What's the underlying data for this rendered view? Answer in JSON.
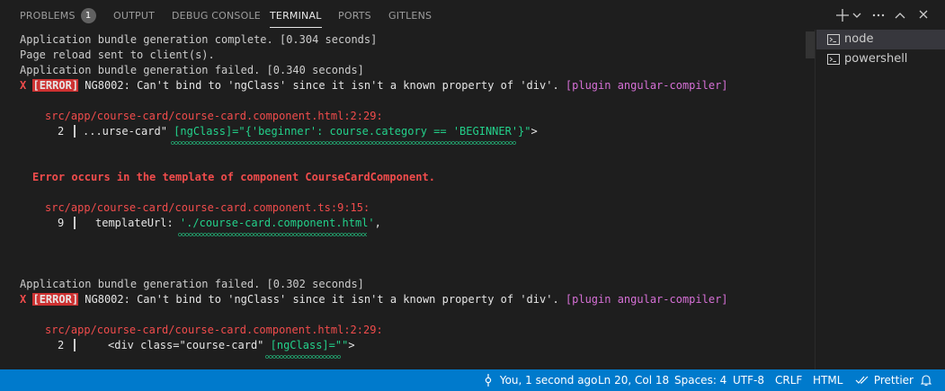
{
  "tabs": [
    {
      "label": "PROBLEMS",
      "badge": "1"
    },
    {
      "label": "OUTPUT"
    },
    {
      "label": "DEBUG CONSOLE"
    },
    {
      "label": "TERMINAL"
    },
    {
      "label": "PORTS"
    },
    {
      "label": "GITLENS"
    }
  ],
  "active_tab": "TERMINAL",
  "terminal_list": [
    {
      "label": "node",
      "icon": "terminal-icon",
      "active": true
    },
    {
      "label": "powershell",
      "icon": "terminal-icon",
      "active": false
    }
  ],
  "terminal": {
    "l1": "Application bundle generation complete. [0.304 seconds]",
    "l2": "Page reload sent to client(s).",
    "l3": "Application bundle generation failed. [0.340 seconds]",
    "l4_x": "X",
    "l4_badge": "[ERROR]",
    "l4_msg": " NG8002: Can't bind to 'ngClass' since it isn't a known property of 'div'. ",
    "l4_plugin": "[plugin angular-compiler]",
    "l5_path": "src/app/course-card/course-card.component.html:2:29:",
    "l6_num": "2",
    "l6_a": "...urse-card\" ",
    "l6_b": "[ngClass]=\"{'beginner': course.category == 'BEGINNER'}\"",
    "l6_c": ">",
    "l7": "Error occurs in the template of component CourseCardComponent.",
    "l8_path": "src/app/course-card/course-card.component.ts:9:15:",
    "l9_num": "9",
    "l9_a": "templateUrl: ",
    "l9_b": "'./course-card.component.html'",
    "l9_c": ",",
    "l10": "Application bundle generation failed. [0.302 seconds]",
    "l11_x": "X",
    "l11_badge": "[ERROR]",
    "l11_msg": " NG8002: Can't bind to 'ngClass' since it isn't a known property of 'div'. ",
    "l11_plugin": "[plugin angular-compiler]",
    "l12_path": "src/app/course-card/course-card.component.html:2:29:",
    "l13_num": "2",
    "l13_a": "<div class=\"course-card\" ",
    "l13_b": "[ngClass]=\"\"",
    "l13_c": ">"
  },
  "status": {
    "blame": "You, 1 second ago",
    "position": "Ln 20, Col 18",
    "spaces": "Spaces: 4",
    "encoding": "UTF-8",
    "eol": "CRLF",
    "language": "HTML",
    "prettier": "Prettier"
  },
  "colors": {
    "accent": "#007acc",
    "error": "#f14c4c",
    "green": "#23d18b",
    "plugin": "#d670d6"
  }
}
